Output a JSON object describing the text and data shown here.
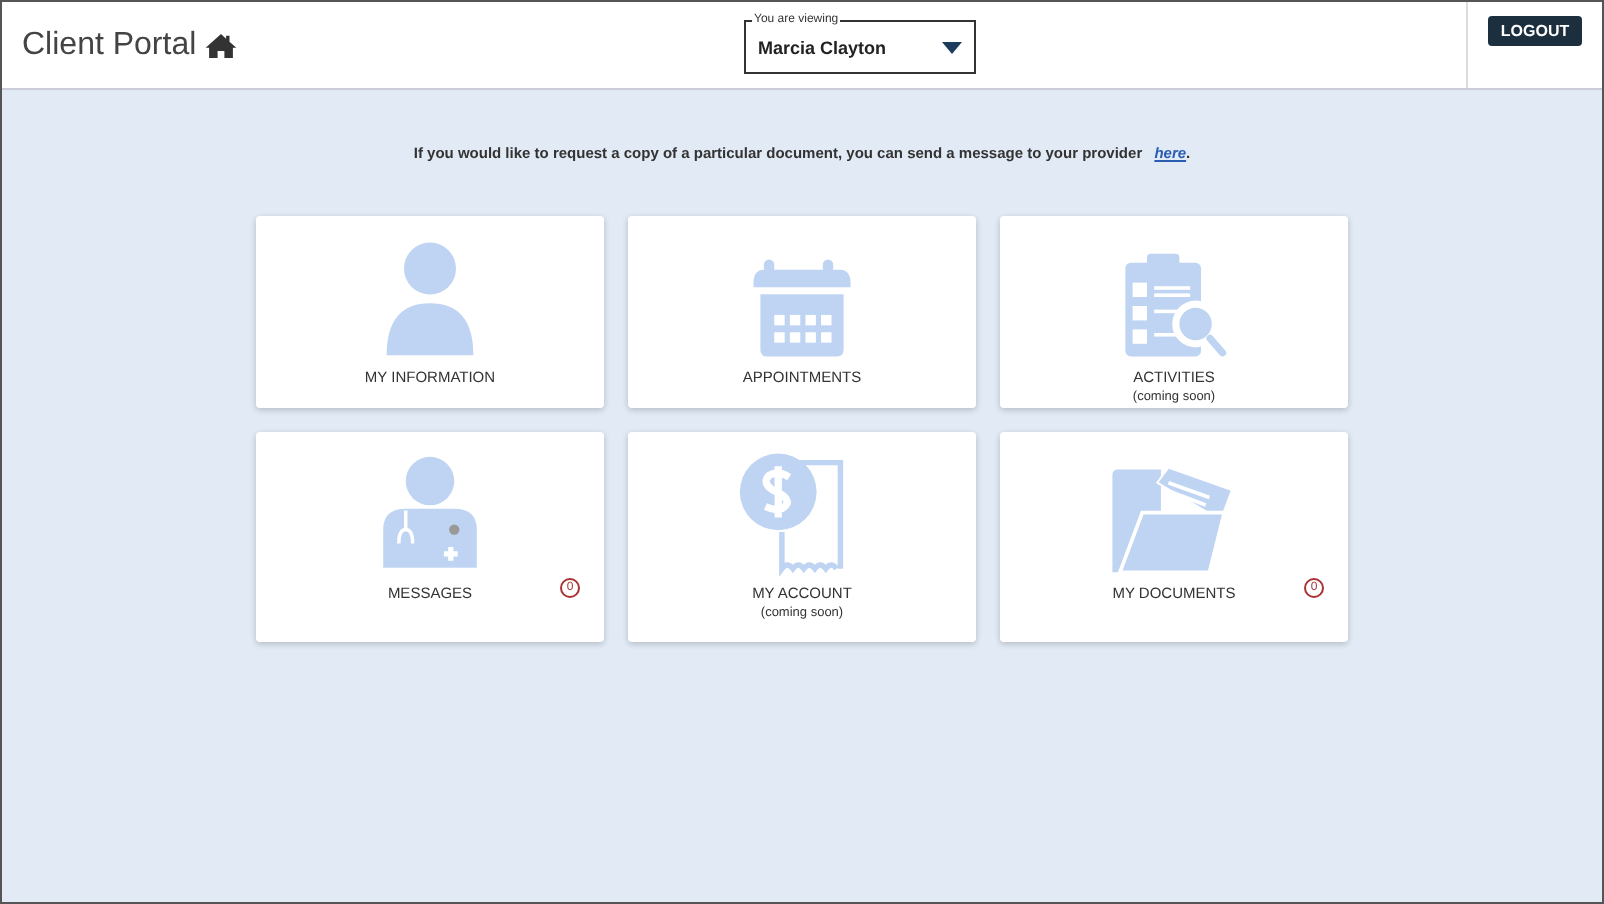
{
  "header": {
    "title": "Client Portal",
    "viewer": {
      "legend": "You are viewing",
      "value": "Marcia Clayton"
    },
    "logout": "LOGOUT"
  },
  "notice": {
    "text": "If you would like to request a copy of a particular document, you can send a message to your provider",
    "link": "here",
    "end": "."
  },
  "tiles": [
    {
      "kind": "person",
      "label": "MY INFORMATION"
    },
    {
      "kind": "calendar",
      "label": "APPOINTMENTS"
    },
    {
      "kind": "clipboard",
      "label": "ACTIVITIES",
      "note": "(coming soon)"
    },
    {
      "kind": "doctor",
      "label": "MESSAGES",
      "badge": "0"
    },
    {
      "kind": "receipt",
      "label": "MY ACCOUNT",
      "note": "(coming soon)"
    },
    {
      "kind": "folder",
      "label": "MY DOCUMENTS",
      "badge": "0"
    }
  ]
}
